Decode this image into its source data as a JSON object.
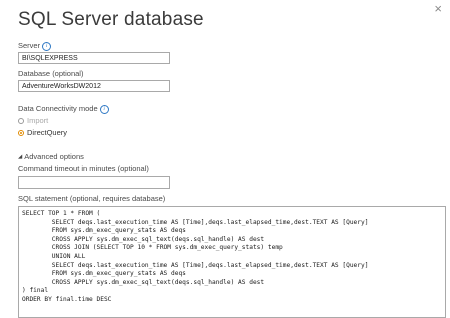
{
  "dialog": {
    "title": "SQL Server database",
    "close_glyph": "×"
  },
  "server": {
    "label": "Server",
    "value": "BI\\SQLEXPRESS"
  },
  "database": {
    "label": "Database (optional)",
    "value": "AdventureWorksDW2012"
  },
  "connectivity": {
    "label": "Data Connectivity mode",
    "options": [
      {
        "label": "Import",
        "selected": false
      },
      {
        "label": "DirectQuery",
        "selected": true
      }
    ]
  },
  "advanced": {
    "toggle_label": "Advanced options",
    "timeout_label": "Command timeout in minutes (optional)",
    "timeout_value": "",
    "sql_label": "SQL statement (optional, requires database)",
    "sql_value": "SELECT TOP 1 * FROM (\n        SELECT deqs.last_execution_time AS [Time],deqs.last_elapsed_time,dest.TEXT AS [Query]\n        FROM sys.dm_exec_query_stats AS deqs\n        CROSS APPLY sys.dm_exec_sql_text(deqs.sql_handle) AS dest\n        CROSS JOIN (SELECT TOP 10 * FROM sys.dm_exec_query_stats) temp\n        UNION ALL\n        SELECT deqs.last_execution_time AS [Time],deqs.last_elapsed_time,dest.TEXT AS [Query]\n        FROM sys.dm_exec_query_stats AS deqs\n        CROSS APPLY sys.dm_exec_sql_text(deqs.sql_handle) AS dest\n) final\nORDER BY final.time DESC"
  },
  "icons": {
    "info": "info-icon",
    "close": "close-icon",
    "expand": "triangle-expanded-icon"
  },
  "colors": {
    "accent_radio": "#e08a00",
    "info_blue": "#2e78c4"
  }
}
